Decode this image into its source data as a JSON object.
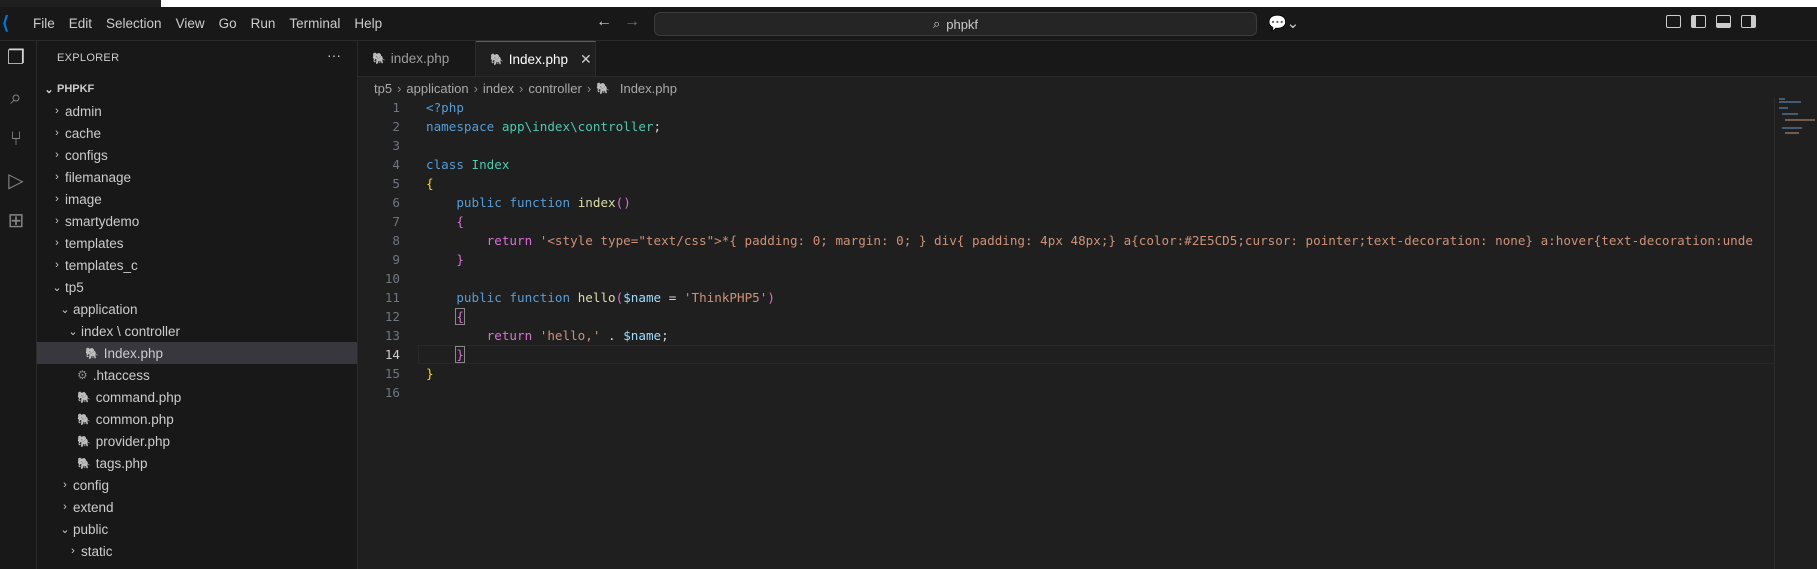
{
  "menu": [
    "File",
    "Edit",
    "Selection",
    "View",
    "Go",
    "Run",
    "Terminal",
    "Help"
  ],
  "search": {
    "text": "phpkf"
  },
  "explorer": {
    "title": "EXPLORER",
    "more": "···",
    "root": "PHPKF",
    "items": [
      {
        "label": "admin",
        "type": "folder",
        "open": false,
        "depth": 0
      },
      {
        "label": "cache",
        "type": "folder",
        "open": false,
        "depth": 0
      },
      {
        "label": "configs",
        "type": "folder",
        "open": false,
        "depth": 0
      },
      {
        "label": "filemanage",
        "type": "folder",
        "open": false,
        "depth": 0
      },
      {
        "label": "image",
        "type": "folder",
        "open": false,
        "depth": 0
      },
      {
        "label": "smartydemo",
        "type": "folder",
        "open": false,
        "depth": 0
      },
      {
        "label": "templates",
        "type": "folder",
        "open": false,
        "depth": 0
      },
      {
        "label": "templates_c",
        "type": "folder",
        "open": false,
        "depth": 0
      },
      {
        "label": "tp5",
        "type": "folder",
        "open": true,
        "depth": 0
      },
      {
        "label": "application",
        "type": "folder",
        "open": true,
        "depth": 1
      },
      {
        "label": "index \\ controller",
        "type": "folder",
        "open": true,
        "depth": 2
      },
      {
        "label": "Index.php",
        "type": "php",
        "depth": 3,
        "selected": true
      },
      {
        "label": ".htaccess",
        "type": "gear",
        "depth": 2
      },
      {
        "label": "command.php",
        "type": "php",
        "depth": 2
      },
      {
        "label": "common.php",
        "type": "php",
        "depth": 2
      },
      {
        "label": "provider.php",
        "type": "php",
        "depth": 2
      },
      {
        "label": "tags.php",
        "type": "php",
        "depth": 2
      },
      {
        "label": "config",
        "type": "folder",
        "open": false,
        "depth": 1
      },
      {
        "label": "extend",
        "type": "folder",
        "open": false,
        "depth": 1
      },
      {
        "label": "public",
        "type": "folder",
        "open": true,
        "depth": 1
      },
      {
        "label": "static",
        "type": "folder",
        "open": false,
        "depth": 2
      }
    ]
  },
  "tabs": [
    {
      "label": "index.php",
      "active": false
    },
    {
      "label": "Index.php",
      "active": true,
      "close": "✕"
    }
  ],
  "breadcrumb": [
    "tp5",
    "application",
    "index",
    "controller",
    "Index.php"
  ],
  "editor": {
    "current_line": 14,
    "lines": [
      "1",
      "2",
      "3",
      "4",
      "5",
      "6",
      "7",
      "8",
      "9",
      "10",
      "11",
      "12",
      "13",
      "14",
      "15",
      "16"
    ]
  },
  "icons": {
    "php": "elephant-icon",
    "htaccess": "gear-icon",
    "colors": {
      "accent": "#0078d4",
      "php_icon": "#a074c4"
    }
  }
}
